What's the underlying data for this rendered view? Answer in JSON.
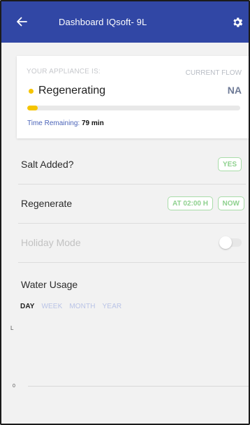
{
  "header": {
    "title": "Dashboard IQsoft- 9L",
    "bg_color": "#3147a5"
  },
  "status_card": {
    "label": "YOUR APPLIANCE IS:",
    "state": "Regenerating",
    "state_color": "#f5c400",
    "flow_label": "CURRENT FLOW",
    "flow_value": "NA",
    "progress_fraction": 0.05,
    "time_label": "Time Remaining:",
    "time_value": "79 min"
  },
  "salt": {
    "label": "Salt Added?",
    "yes_label": "YES"
  },
  "regenerate": {
    "label": "Regenerate",
    "at_label": "AT 02:00 H",
    "now_label": "NOW"
  },
  "holiday": {
    "label": "Holiday Mode",
    "enabled": false
  },
  "usage": {
    "title": "Water Usage",
    "tabs": [
      "DAY",
      "WEEK",
      "MONTH",
      "YEAR"
    ],
    "active_tab": "DAY",
    "y_unit": "L",
    "y_zero": "0"
  },
  "icons": {
    "back": "arrow-left-icon",
    "settings": "gear-icon"
  }
}
